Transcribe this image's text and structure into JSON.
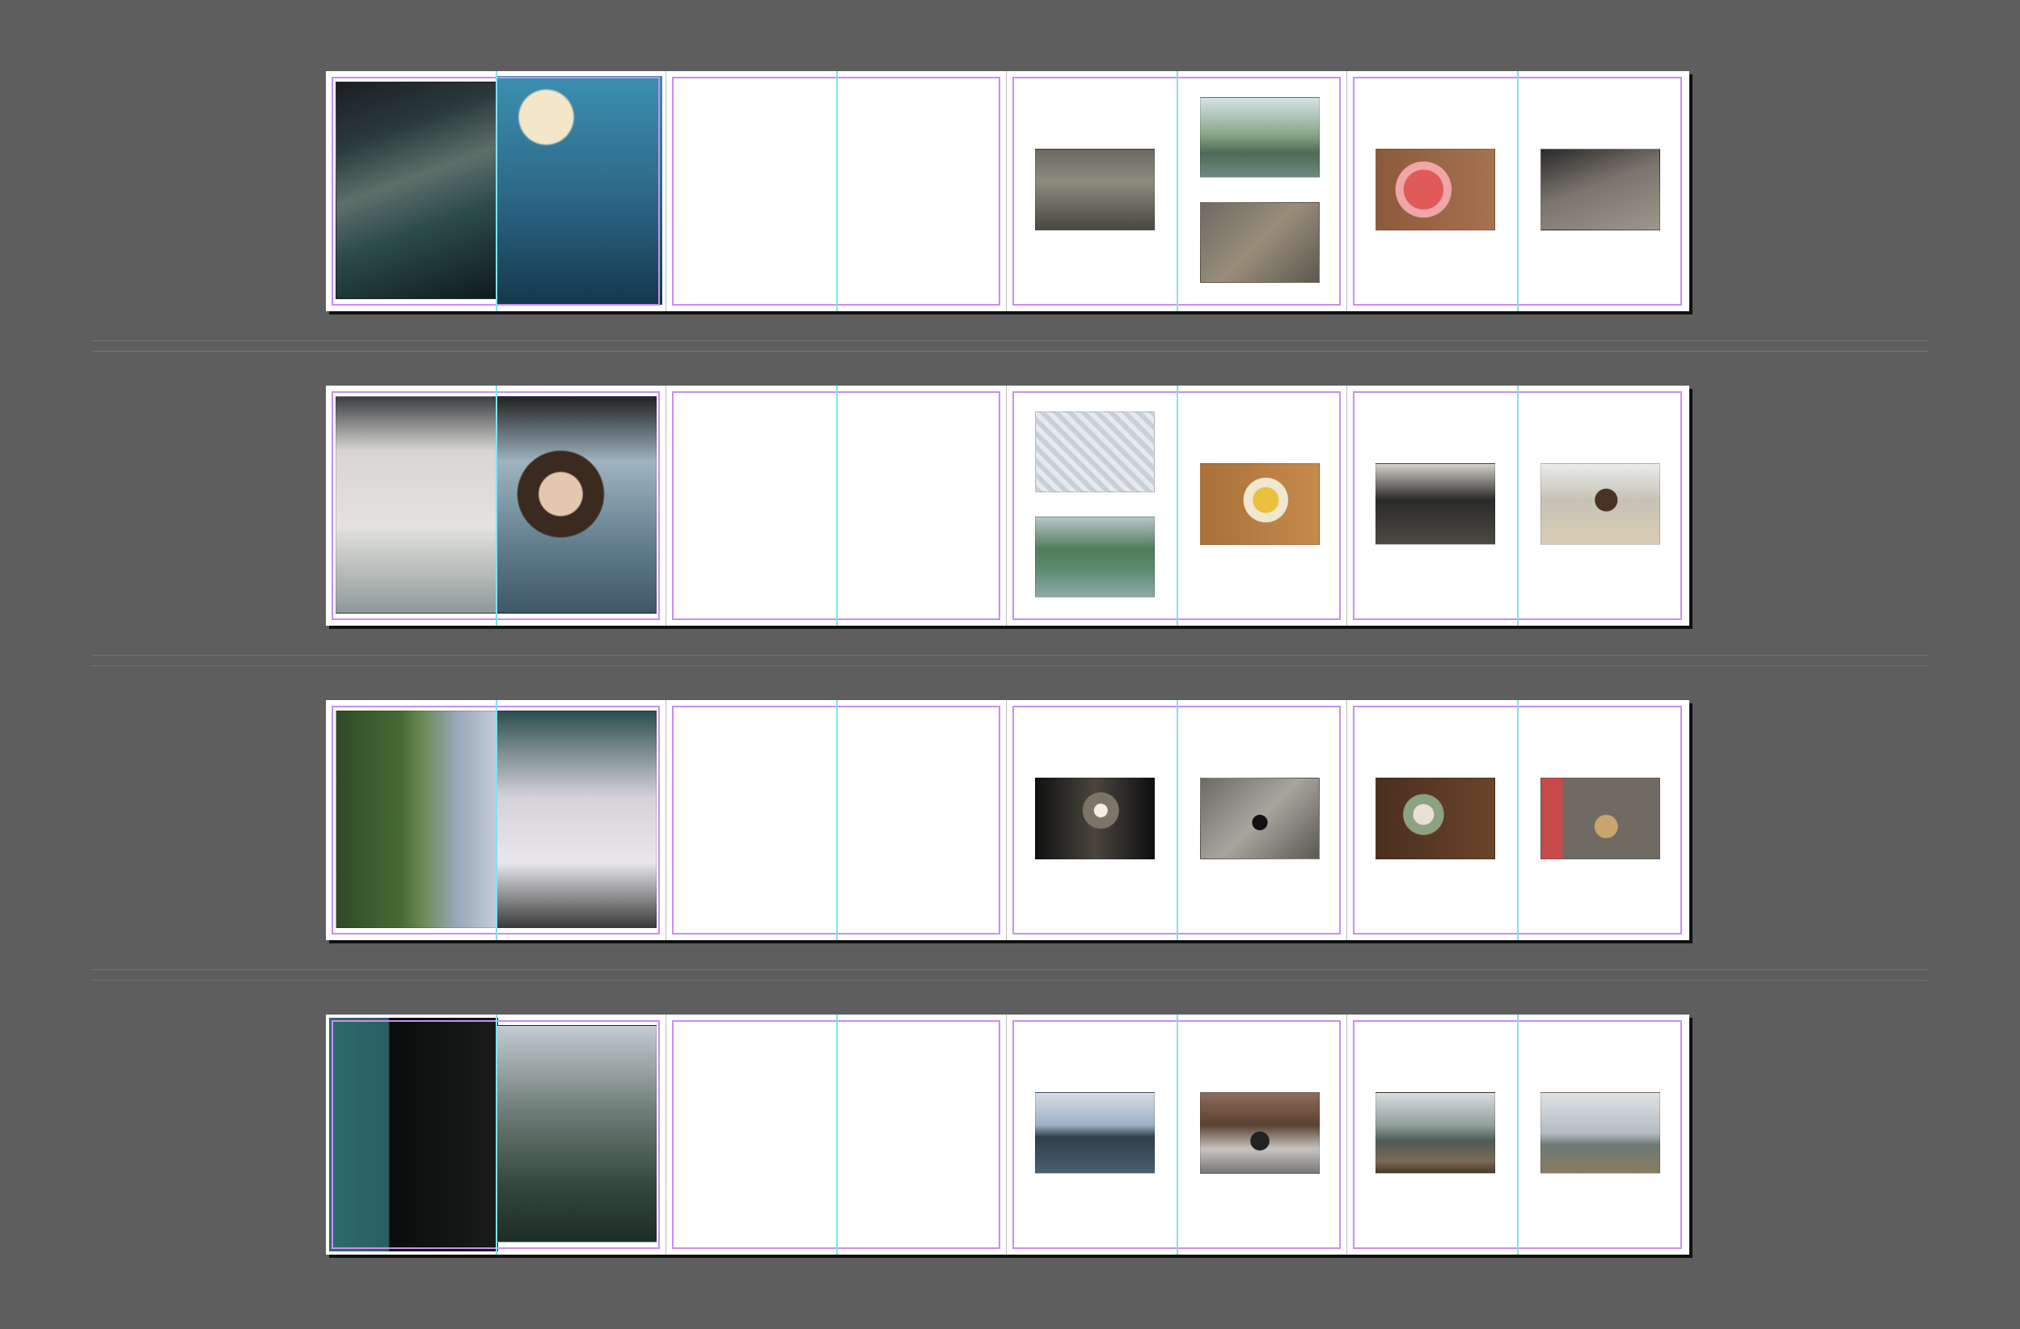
{
  "window": {
    "background": "#5e5e5e"
  },
  "guides": {
    "margin_color": "#c98ef0",
    "fold_color": "#7fe3f3"
  },
  "rows": [
    {
      "spreads": [
        {
          "photos": [
            "boat-rider-photo",
            "coconut-hand-photo"
          ]
        },
        {
          "photos": []
        },
        {
          "photos": [
            "ruins-photo",
            "river-photo",
            "cat-floor-photo"
          ]
        },
        {
          "photos": [
            "watermelon-plate-photo",
            "motorbike-photo"
          ]
        }
      ]
    },
    {
      "spreads": [
        {
          "photos": [
            "boat-woman-photo",
            "woman-portrait-photo"
          ]
        },
        {
          "photos": []
        },
        {
          "photos": [
            "breakfast-photo",
            "lake-dock-photo",
            "fruit-tray-photo"
          ]
        },
        {
          "photos": [
            "window-view-photo",
            "beach-woman-photo"
          ]
        }
      ]
    },
    {
      "spreads": [
        {
          "photos": [
            "jungle-cliff-photo",
            "boat-canopy-photo"
          ]
        },
        {
          "photos": []
        },
        {
          "photos": [
            "cave-photo",
            "cat-rock-photo"
          ]
        },
        {
          "photos": [
            "rice-plate-photo",
            "dog-street-photo"
          ]
        }
      ]
    },
    {
      "spreads": [
        {
          "photos": [
            "sea-night-photo",
            "misty-cliff-photo"
          ]
        },
        {
          "photos": []
        },
        {
          "photos": [
            "blue-lake-photo",
            "cat-trees-photo"
          ]
        },
        {
          "photos": [
            "longtail-boat-photo",
            "boat-standing-photo"
          ]
        }
      ]
    }
  ]
}
